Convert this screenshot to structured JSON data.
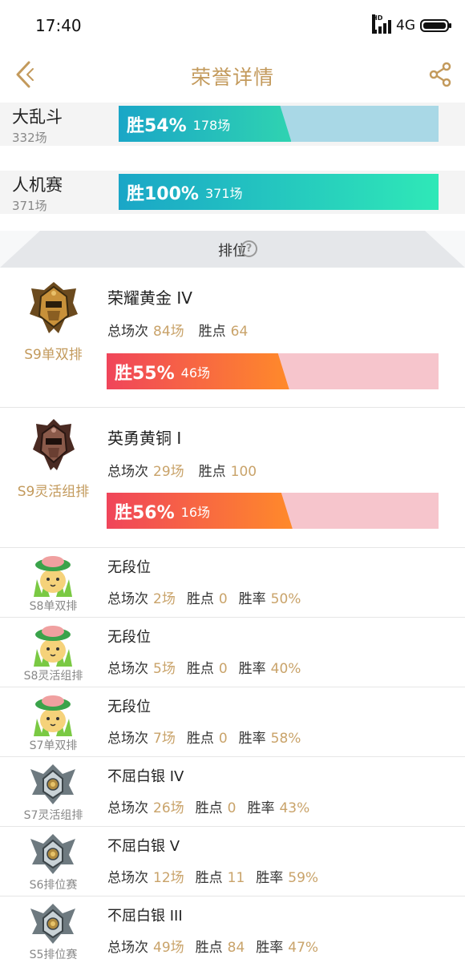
{
  "status_bar": {
    "time": "17:40",
    "hd": "HD",
    "network": "4G"
  },
  "nav": {
    "title": "荣誉详情",
    "back_icon": "back-chevron-icon",
    "share_icon": "share-icon"
  },
  "modes": [
    {
      "name": "大乱斗",
      "count": "332场",
      "win_label": "胜54%",
      "games_label": "178场",
      "win_rate": 0.54,
      "fill_colors": [
        "#1aa6c7",
        "#2fd3b1"
      ],
      "track_color": "#a9d8e6"
    },
    {
      "name": "人机赛",
      "count": "371场",
      "win_label": "胜100%",
      "games_label": "371场",
      "win_rate": 1.0,
      "fill_colors": [
        "#1aa6c7",
        "#2fe8b7"
      ],
      "track_color": "#a9d8e6"
    }
  ],
  "ranked": {
    "title": "排位",
    "help_icon": "question-circle-icon",
    "big_entries": [
      {
        "season": "S9单双排",
        "tier": "荣耀黄金 IV",
        "total_label": "总场次",
        "total_value": "84场",
        "points_label": "胜点",
        "points_value": "64",
        "win_label": "胜55%",
        "games_label": "46场",
        "win_rate": 0.55,
        "emblem": "gold-emblem-icon"
      },
      {
        "season": "S9灵活组排",
        "tier": "英勇黄铜 I",
        "total_label": "总场次",
        "total_value": "29场",
        "points_label": "胜点",
        "points_value": "100",
        "win_label": "胜56%",
        "games_label": "16场",
        "win_rate": 0.56,
        "emblem": "bronze-emblem-icon"
      }
    ],
    "small_entries": [
      {
        "season": "S8单双排",
        "tier": "无段位",
        "total_label": "总场次",
        "total_value": "2场",
        "points_label": "胜点",
        "points_value": "0",
        "rate_label": "胜率",
        "rate_value": "50%",
        "emblem": "unranked-mascot-icon"
      },
      {
        "season": "S8灵活组排",
        "tier": "无段位",
        "total_label": "总场次",
        "total_value": "5场",
        "points_label": "胜点",
        "points_value": "0",
        "rate_label": "胜率",
        "rate_value": "40%",
        "emblem": "unranked-mascot-icon"
      },
      {
        "season": "S7单双排",
        "tier": "无段位",
        "total_label": "总场次",
        "total_value": "7场",
        "points_label": "胜点",
        "points_value": "0",
        "rate_label": "胜率",
        "rate_value": "58%",
        "emblem": "unranked-mascot-icon"
      },
      {
        "season": "S7灵活组排",
        "tier": "不屈白银 IV",
        "total_label": "总场次",
        "total_value": "26场",
        "points_label": "胜点",
        "points_value": "0",
        "rate_label": "胜率",
        "rate_value": "43%",
        "emblem": "silver-emblem-icon"
      },
      {
        "season": "S6排位赛",
        "tier": "不屈白银 V",
        "total_label": "总场次",
        "total_value": "12场",
        "points_label": "胜点",
        "points_value": "11",
        "rate_label": "胜率",
        "rate_value": "59%",
        "emblem": "silver-emblem-icon"
      },
      {
        "season": "S5排位赛",
        "tier": "不屈白银 III",
        "total_label": "总场次",
        "total_value": "49场",
        "points_label": "胜点",
        "points_value": "84",
        "rate_label": "胜率",
        "rate_value": "47%",
        "emblem": "silver-emblem-icon"
      }
    ]
  },
  "colors": {
    "accent_gold": "#c39a5c",
    "value_gold": "#c9a36a",
    "ranked_fill_start": "#f0455a",
    "ranked_fill_end": "#ff8a2a",
    "ranked_track": "#f6c5cc"
  }
}
